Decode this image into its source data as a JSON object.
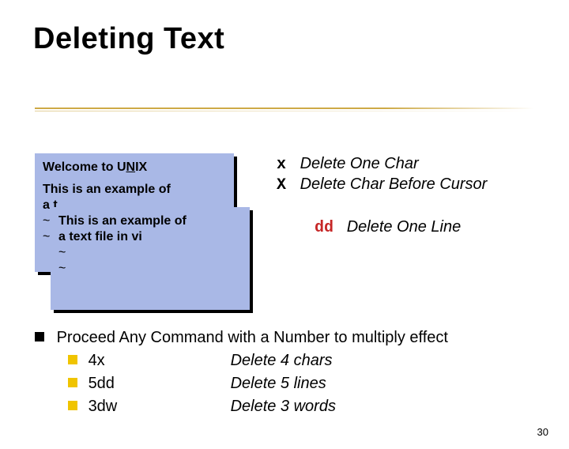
{
  "title": "Deleting Text",
  "pane1": {
    "line1a": "Welcome to U",
    "line1b": "N",
    "line1c": "IX",
    "line2": "This is an example of",
    "line3": "a t",
    "line4": "~",
    "line5": "~"
  },
  "pane2": {
    "line1": "This is an example of",
    "line2": "a text file in vi",
    "line3": "~",
    "line4": "~"
  },
  "commands": {
    "x": {
      "key": "x",
      "desc": "Delete One Char"
    },
    "X": {
      "key": "X",
      "desc": "Delete Char Before Cursor"
    },
    "dd": {
      "key": "dd",
      "desc": "Delete One Line"
    }
  },
  "note": "Proceed Any Command with a Number to multiply effect",
  "examples": [
    {
      "cmd": "4x",
      "meaning": "Delete 4 chars"
    },
    {
      "cmd": "5dd",
      "meaning": "Delete 5 lines"
    },
    {
      "cmd": "3dw",
      "meaning": "Delete 3 words"
    }
  ],
  "page": "30"
}
